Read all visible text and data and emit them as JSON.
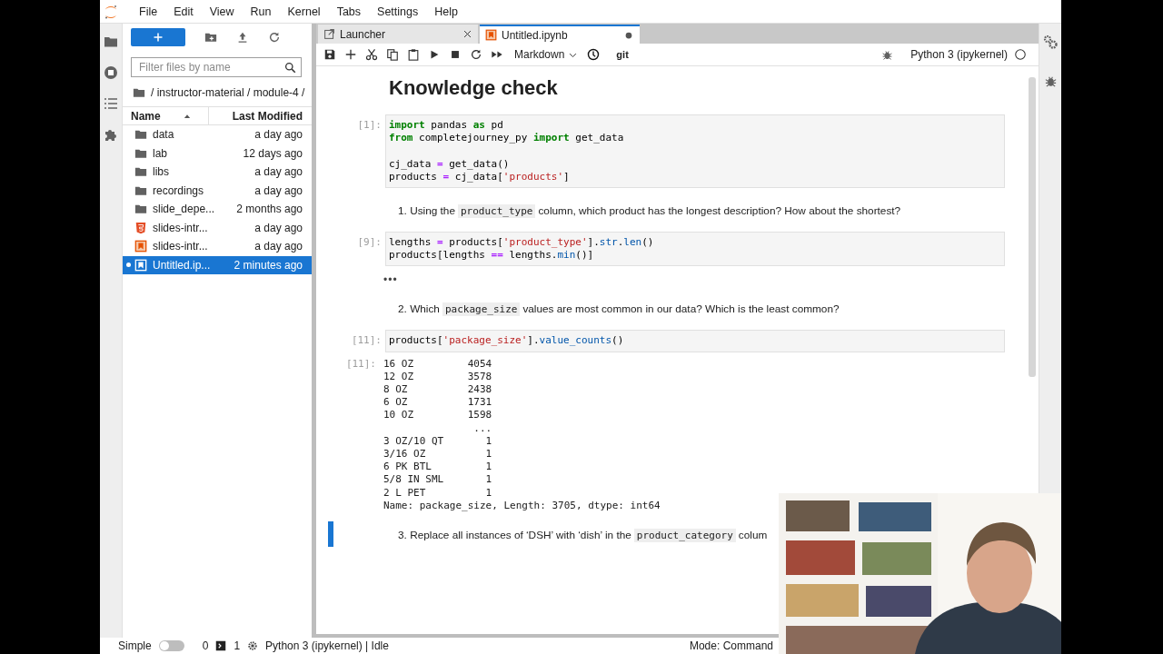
{
  "menu": [
    "File",
    "Edit",
    "View",
    "Run",
    "Kernel",
    "Tabs",
    "Settings",
    "Help"
  ],
  "file_browser": {
    "filter_placeholder": "Filter files by name",
    "path": "/ instructor-material / module-4 /",
    "columns": [
      {
        "label": "Name",
        "sorted": true
      },
      {
        "label": "Last Modified",
        "sorted": false
      }
    ],
    "files": [
      {
        "kind": "folder",
        "name": "data",
        "modified": "a day ago",
        "selected": false,
        "running": false
      },
      {
        "kind": "folder",
        "name": "lab",
        "modified": "12 days ago",
        "selected": false,
        "running": false
      },
      {
        "kind": "folder",
        "name": "libs",
        "modified": "a day ago",
        "selected": false,
        "running": false
      },
      {
        "kind": "folder",
        "name": "recordings",
        "modified": "a day ago",
        "selected": false,
        "running": false
      },
      {
        "kind": "folder",
        "name": "slide_depe...",
        "modified": "2 months ago",
        "selected": false,
        "running": false
      },
      {
        "kind": "html",
        "name": "slides-intr...",
        "modified": "a day ago",
        "selected": false,
        "running": false
      },
      {
        "kind": "slides",
        "name": "slides-intr...",
        "modified": "a day ago",
        "selected": false,
        "running": false
      },
      {
        "kind": "notebook",
        "name": "Untitled.ip...",
        "modified": "2 minutes ago",
        "selected": true,
        "running": true
      }
    ]
  },
  "tabs": [
    {
      "kind": "launcher",
      "label": "Launcher",
      "selected": false,
      "modified": false
    },
    {
      "kind": "notebook",
      "label": "Untitled.ipynb",
      "selected": true,
      "modified": true
    }
  ],
  "toolbar": {
    "cell_type": "Markdown",
    "git": "git",
    "kernel": "Python 3 (ipykernel)"
  },
  "cells": [
    {
      "kind": "heading",
      "text": "Knowledge check",
      "selected": false
    },
    {
      "kind": "code",
      "prompt": "[1]:",
      "selected": false,
      "lines": [
        {
          "tokens": [
            {
              "kind": "kw",
              "text": "import"
            },
            {
              "kind": "plain",
              "text": " pandas "
            },
            {
              "kind": "kw",
              "text": "as"
            },
            {
              "kind": "plain",
              "text": " pd"
            }
          ]
        },
        {
          "tokens": [
            {
              "kind": "kw",
              "text": "from"
            },
            {
              "kind": "plain",
              "text": " completejourney_py "
            },
            {
              "kind": "kw",
              "text": "import"
            },
            {
              "kind": "plain",
              "text": " get_data"
            }
          ]
        },
        {
          "blank_before": true,
          "tokens": [
            {
              "kind": "plain",
              "text": "cj_data "
            },
            {
              "kind": "op",
              "text": "="
            },
            {
              "kind": "plain",
              "text": " get_data()"
            }
          ]
        },
        {
          "tokens": [
            {
              "kind": "plain",
              "text": "products "
            },
            {
              "kind": "op",
              "text": "="
            },
            {
              "kind": "plain",
              "text": " cj_data["
            },
            {
              "kind": "str",
              "text": "'products'"
            },
            {
              "kind": "plain",
              "text": "]"
            }
          ]
        }
      ]
    },
    {
      "kind": "markdown",
      "number": "1.",
      "selected": false,
      "parts": [
        {
          "kind": "text",
          "text": "Using the"
        },
        {
          "kind": "code",
          "text": "product_type"
        },
        {
          "kind": "text",
          "text": "column, which product has the longest description? How about the shortest?"
        }
      ]
    },
    {
      "kind": "code",
      "prompt": "[9]:",
      "selected": false,
      "lines": [
        {
          "tokens": [
            {
              "kind": "plain",
              "text": "lengths "
            },
            {
              "kind": "op",
              "text": "="
            },
            {
              "kind": "plain",
              "text": " products["
            },
            {
              "kind": "str",
              "text": "'product_type'"
            },
            {
              "kind": "plain",
              "text": "]."
            },
            {
              "kind": "fn",
              "text": "str"
            },
            {
              "kind": "plain",
              "text": "."
            },
            {
              "kind": "fn",
              "text": "len"
            },
            {
              "kind": "plain",
              "text": "()"
            }
          ]
        },
        {
          "tokens": [
            {
              "kind": "plain",
              "text": "products[lengths "
            },
            {
              "kind": "op",
              "text": "=="
            },
            {
              "kind": "plain",
              "text": " lengths."
            },
            {
              "kind": "fn",
              "text": "min"
            },
            {
              "kind": "plain",
              "text": "()]"
            }
          ]
        }
      ],
      "output": {
        "kind": "collapsed",
        "text": "•••"
      }
    },
    {
      "kind": "markdown",
      "number": "2.",
      "selected": false,
      "parts": [
        {
          "kind": "text",
          "text": "Which"
        },
        {
          "kind": "code",
          "text": "package_size"
        },
        {
          "kind": "text",
          "text": "values are most common in our data? Which is the least common?"
        }
      ]
    },
    {
      "kind": "code",
      "prompt": "[11]:",
      "selected": false,
      "lines": [
        {
          "tokens": [
            {
              "kind": "plain",
              "text": "products["
            },
            {
              "kind": "str",
              "text": "'package_size'"
            },
            {
              "kind": "plain",
              "text": "]."
            },
            {
              "kind": "fn",
              "text": "value_counts"
            },
            {
              "kind": "plain",
              "text": "()"
            }
          ]
        }
      ],
      "output": {
        "kind": "text",
        "prompt": "[11]:",
        "lines": [
          "16 OZ         4054",
          "12 OZ         3578",
          "8 OZ          2438",
          "6 OZ          1731",
          "10 OZ         1598",
          "               ...",
          "3 OZ/10 QT       1",
          "3/16 OZ          1",
          "6 PK BTL         1",
          "5/8 IN SML       1",
          "2 L PET          1",
          "Name: package_size, Length: 3705, dtype: int64"
        ]
      }
    },
    {
      "kind": "markdown",
      "number": "3.",
      "selected": true,
      "parts": [
        {
          "kind": "text",
          "text": "Replace all instances of ‘DSH’ with ‘dish’ in the"
        },
        {
          "kind": "code",
          "text": "product_category"
        },
        {
          "kind": "text",
          "text": "colum"
        }
      ]
    }
  ],
  "status_bar": {
    "mode_label": "Simple",
    "simple_on": false,
    "terminals": "0",
    "kernels": "1",
    "kernel_status": "Python 3 (ipykernel) | Idle",
    "mode": "Mode: Command"
  },
  "webcam": {
    "kind": "picture"
  }
}
